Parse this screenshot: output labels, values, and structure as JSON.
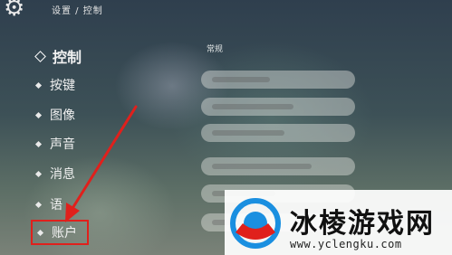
{
  "topbar": {
    "gear_icon": "gear-icon",
    "breadcrumb": "设置 / 控制"
  },
  "sidebar": {
    "items": [
      {
        "label": "控制",
        "state": "active"
      },
      {
        "label": "按键"
      },
      {
        "label": "图像"
      },
      {
        "label": "声音"
      },
      {
        "label": "消息"
      },
      {
        "label": "语"
      },
      {
        "label": "账户",
        "state": "highlighted"
      }
    ]
  },
  "content": {
    "rows_count_visible": 9
  },
  "annotation": {
    "color": "#e0201c"
  },
  "watermark": {
    "title": "冰棱游戏网",
    "url": "www.yclengku.com",
    "brand_color": "#1a8fe0"
  }
}
